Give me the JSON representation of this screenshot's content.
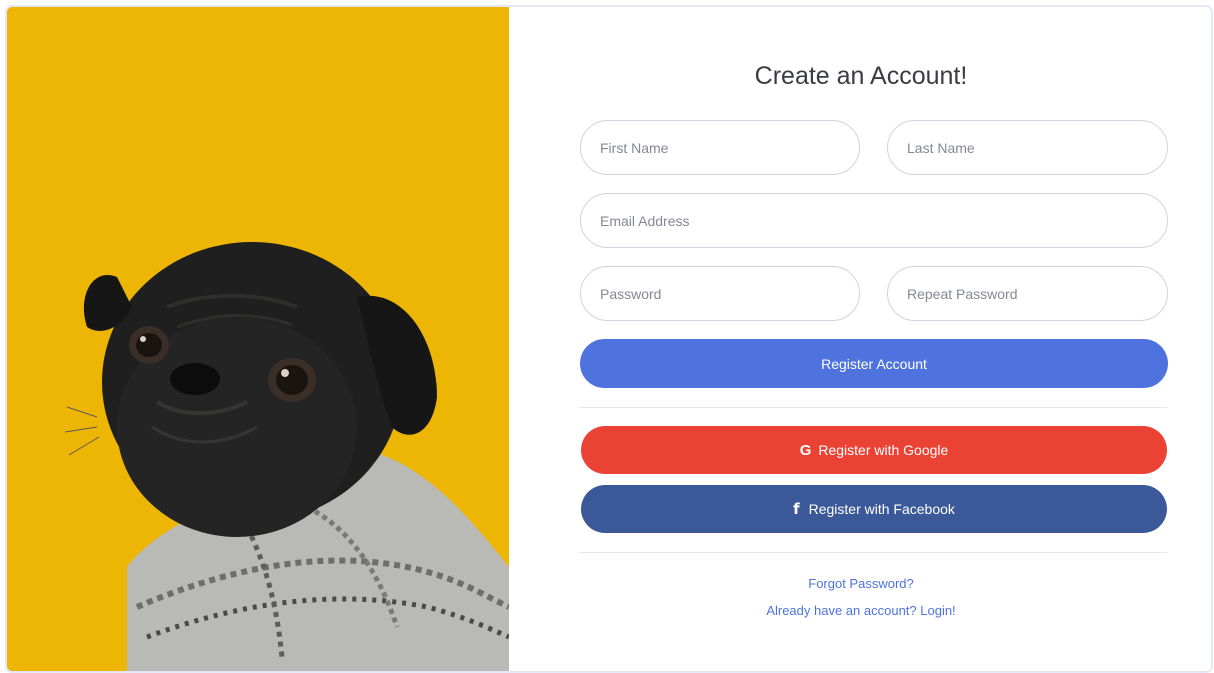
{
  "form": {
    "title": "Create an Account!",
    "first_name_placeholder": "First Name",
    "last_name_placeholder": "Last Name",
    "email_placeholder": "Email Address",
    "password_placeholder": "Password",
    "repeat_password_placeholder": "Repeat Password",
    "register_label": "Register Account",
    "google_label": "Register with Google",
    "google_icon": "G",
    "facebook_label": "Register with Facebook",
    "facebook_icon": "f",
    "forgot_password_link": "Forgot Password?",
    "login_link": "Already have an account? Login!"
  },
  "image": {
    "subject": "pug-in-knit-sweater",
    "background_color": "#eeb604"
  },
  "colors": {
    "primary": "#4e73df",
    "google": "#ea4335",
    "facebook": "#3b5998"
  }
}
